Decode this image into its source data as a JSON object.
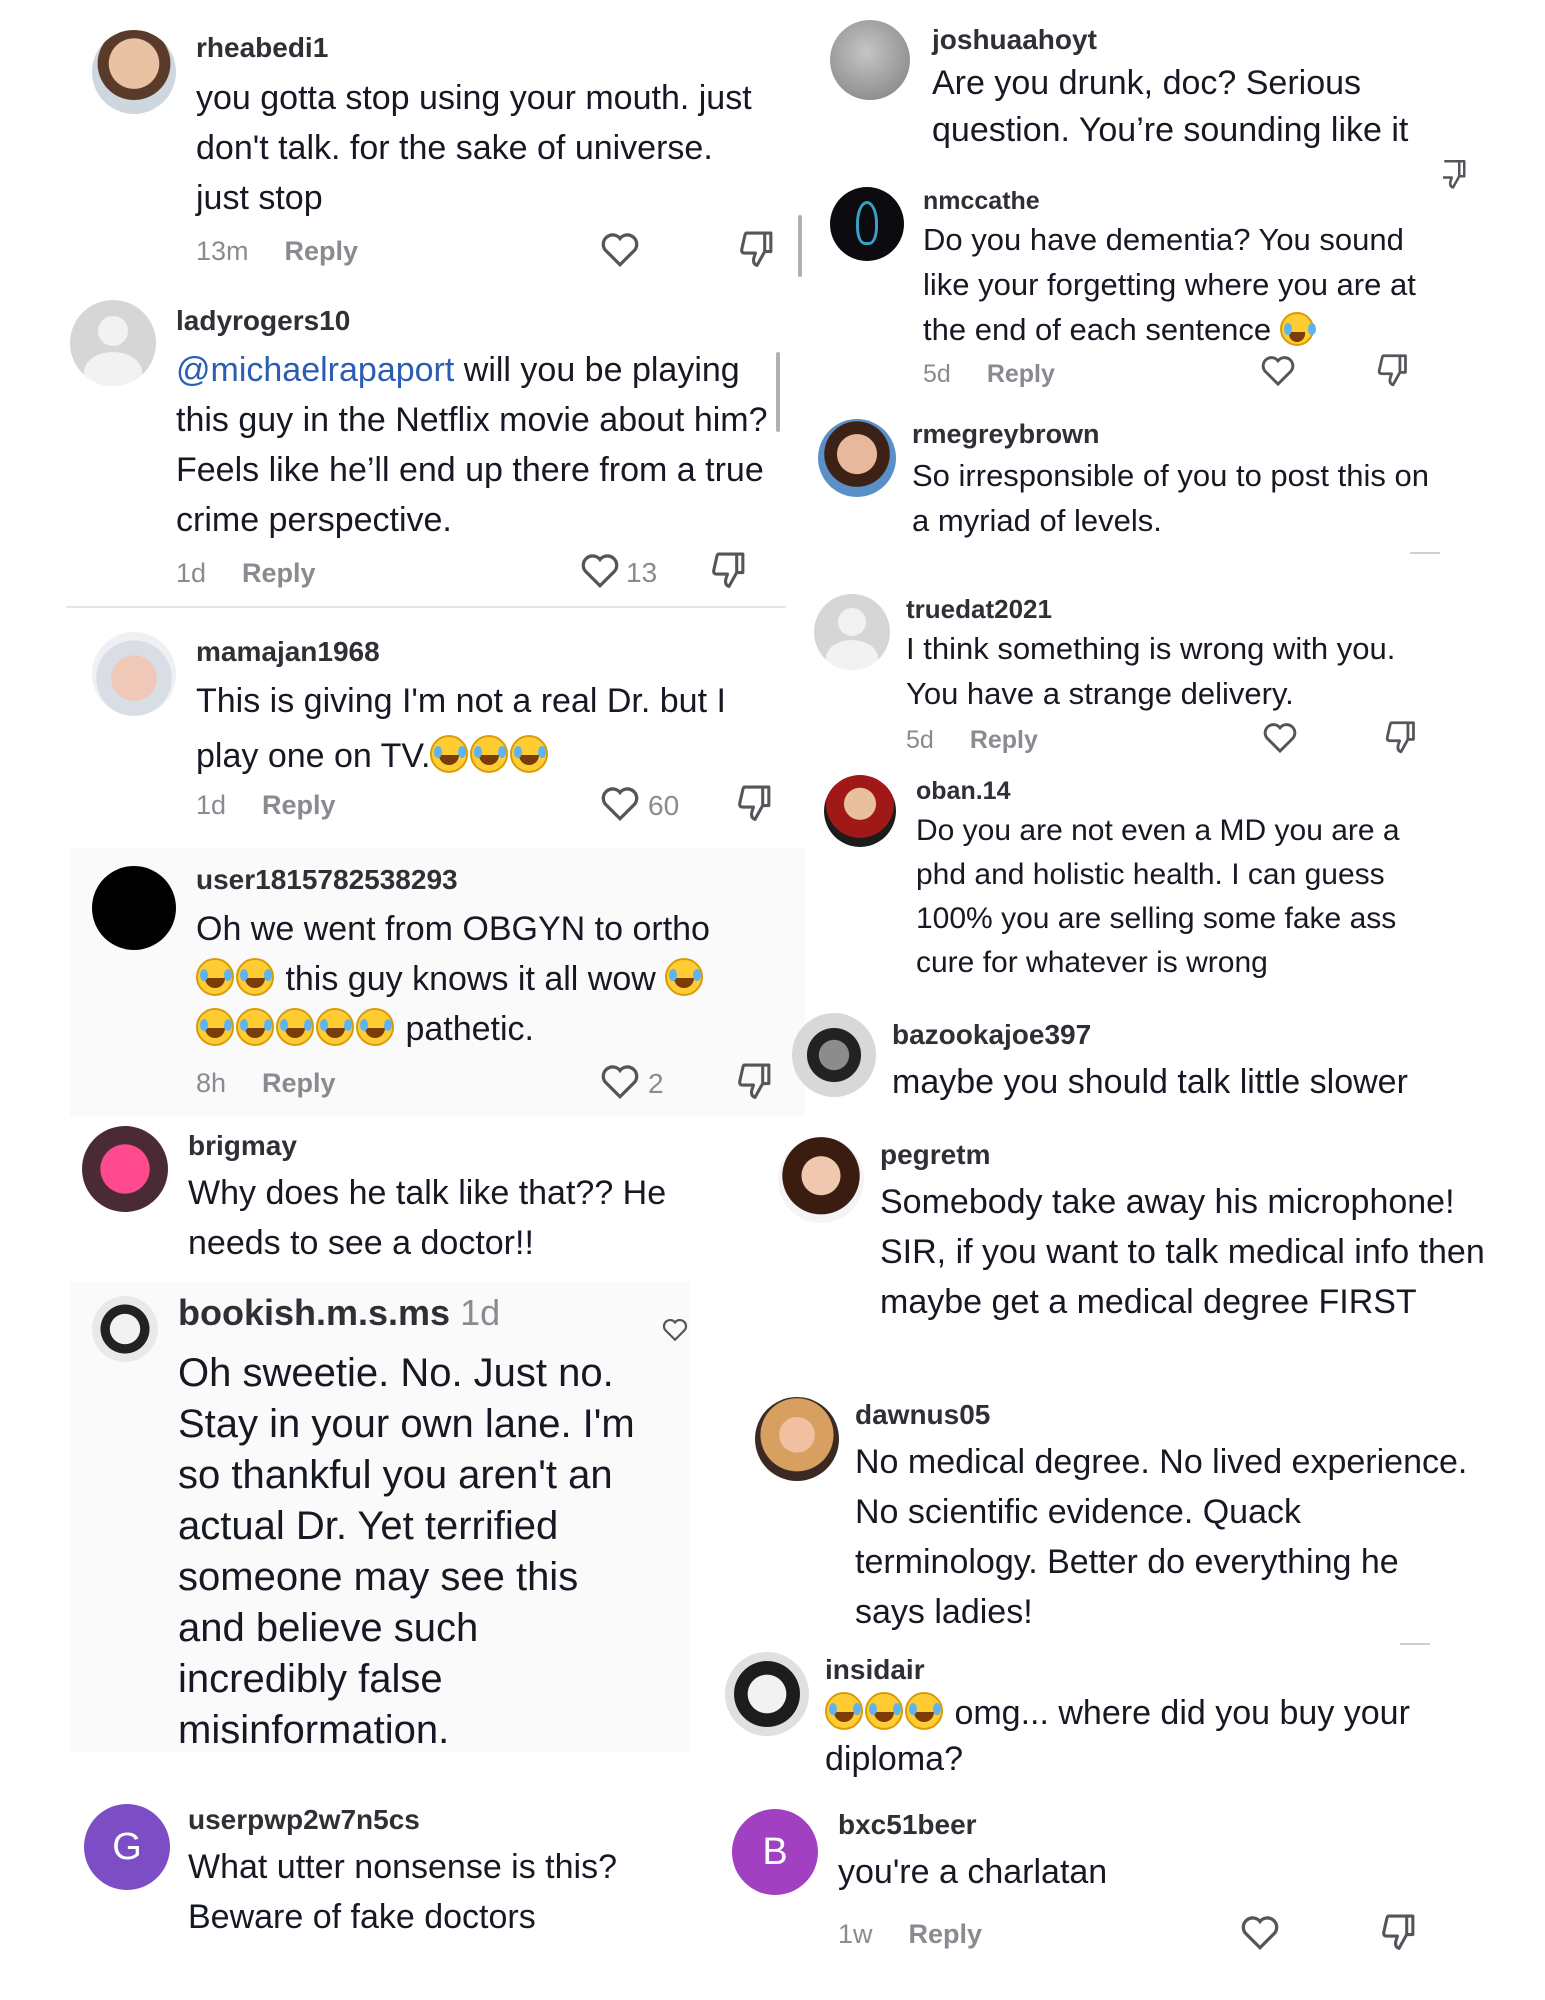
{
  "colors": {
    "mention": "#2b5db5",
    "text": "#161823",
    "meta": "#8a8b91",
    "avatar_g": "#7c4dc4",
    "avatar_b": "#a240c2"
  },
  "comments": [
    {
      "user": "rheabedi1",
      "text": "you gotta stop using your mouth. just don't talk. for the sake of universe. just stop",
      "time": "13m",
      "reply": "Reply"
    },
    {
      "user": "ladyrogers10",
      "mention": "@michaelrapaport",
      "text": " will you be playing this guy in the Netflix movie about him? Feels like he’ll end up there from a true crime perspective.",
      "time": "1d",
      "reply": "Reply",
      "likes": "13"
    },
    {
      "user": "mamajan1968",
      "text": "This is giving I'm not a real Dr. but I play one on TV.",
      "time": "1d",
      "reply": "Reply",
      "likes": "60"
    },
    {
      "user": "user1815782538293",
      "text_a": "Oh we went from OBGYN to ortho",
      "text_b": " this guy knows it all wow ",
      "text_c": " pathetic.",
      "time": "8h",
      "reply": "Reply",
      "likes": "2"
    },
    {
      "user": "brigmay",
      "text": "Why does he talk like that?? He needs to see a doctor!!"
    },
    {
      "user": "bookish.m.s.ms",
      "time": "1d",
      "text": "Oh sweetie. No. Just no. Stay in your own lane. I'm so thankful you aren't an actual Dr. Yet terrified someone may see this and believe such incredibly false misinformation."
    },
    {
      "user": "userpwp2w7n5cs",
      "avatar_letter": "G",
      "text": "What utter nonsense is this? Beware of fake doctors"
    },
    {
      "user": "joshuaahoyt",
      "text": "Are you drunk, doc? Serious question. You’re sounding like it"
    },
    {
      "user": "nmccathe",
      "text": "Do you have dementia? You sound like your forgetting where you are at the end of each sentence",
      "time": "5d",
      "reply": "Reply"
    },
    {
      "user": "rmegreybrown",
      "text": "So irresponsible of you to post this on a myriad of levels."
    },
    {
      "user": "truedat2021",
      "text": "I think something is wrong with you. You have a strange delivery.",
      "time": "5d",
      "reply": "Reply"
    },
    {
      "user": "oban.14",
      "text": "Do you are not even a MD you are a phd and holistic health. I can guess 100% you are selling some fake ass cure for whatever is wrong"
    },
    {
      "user": "bazookajoe397",
      "text": "maybe you should talk little slower"
    },
    {
      "user": "pegretm",
      "text": "Somebody take away his microphone! SIR, if you want to talk medical info then maybe get a medical degree FIRST"
    },
    {
      "user": "dawnus05",
      "text": "No medical degree. No lived experience. No scientific evidence. Quack terminology. Better do everything he says ladies!"
    },
    {
      "user": "insidair",
      "text": " omg... where did you buy your diploma?"
    },
    {
      "user": "bxc51beer",
      "avatar_letter": "B",
      "text": "you're a charlatan",
      "time": "1w",
      "reply": "Reply"
    }
  ]
}
